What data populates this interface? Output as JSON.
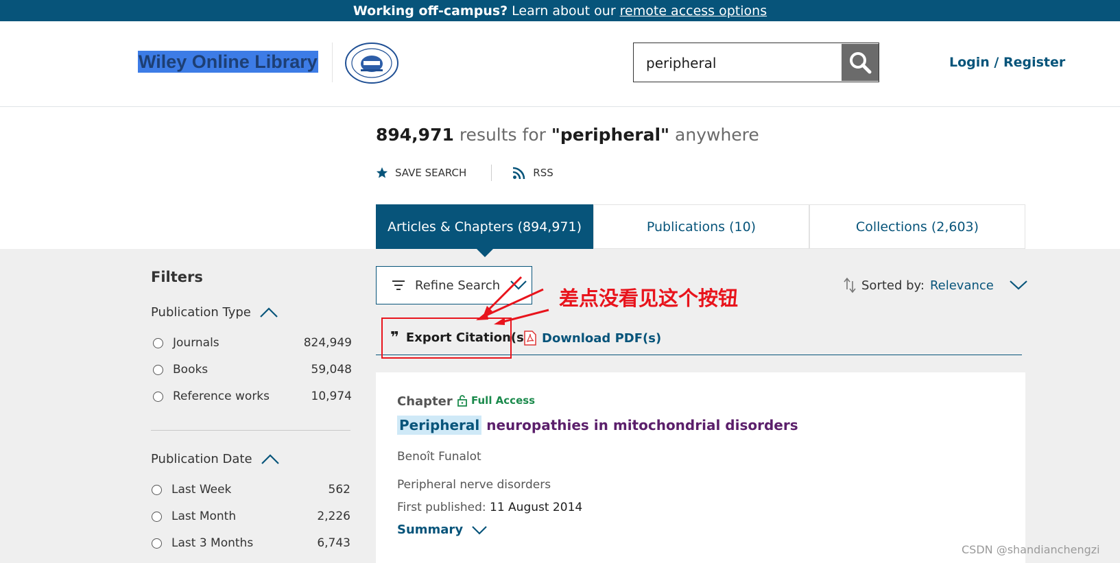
{
  "banner": {
    "bold": "Working off-campus?",
    "text": "Learn about our",
    "link": "remote access options"
  },
  "header": {
    "logo": "Wiley Online Library",
    "search_value": "peripheral",
    "login": "Login / Register"
  },
  "results": {
    "count": "894,971",
    "text": "results for",
    "query": "\"peripheral\"",
    "scope": "anywhere",
    "save_search": "SAVE SEARCH",
    "rss": "RSS"
  },
  "tabs": [
    {
      "label": "Articles & Chapters (894,971)",
      "active": true
    },
    {
      "label": "Publications (10)",
      "active": false
    },
    {
      "label": "Collections (2,603)",
      "active": false
    }
  ],
  "filters": {
    "title": "Filters",
    "publication_type": {
      "title": "Publication Type",
      "items": [
        {
          "name": "Journals",
          "count": "824,949"
        },
        {
          "name": "Books",
          "count": "59,048"
        },
        {
          "name": "Reference works",
          "count": "10,974"
        }
      ]
    },
    "publication_date": {
      "title": "Publication Date",
      "items": [
        {
          "name": "Last Week",
          "count": "562"
        },
        {
          "name": "Last Month",
          "count": "2,226"
        },
        {
          "name": "Last 3 Months",
          "count": "6,743"
        }
      ]
    }
  },
  "toolbar": {
    "refine": "Refine Search",
    "sorted_label": "Sorted by:",
    "sorted_value": "Relevance",
    "export": "Export Citation(s)",
    "download": "Download PDF(s)"
  },
  "annotation": "差点没看见这个按钮",
  "result": {
    "type": "Chapter",
    "access": "Full Access",
    "title_highlight": "Peripheral",
    "title_rest": "neuropathies in mitochondrial disorders",
    "author": "Benoît Funalot",
    "source": "Peripheral nerve disorders",
    "published_label": "First published:",
    "published_date": "11 August 2014",
    "summary": "Summary"
  },
  "watermark": "CSDN @shandianchengzi",
  "colors": {
    "brand": "#07547a",
    "annotation": "#e8141c",
    "access": "#1b8a4c",
    "title": "#5b1f6b"
  }
}
